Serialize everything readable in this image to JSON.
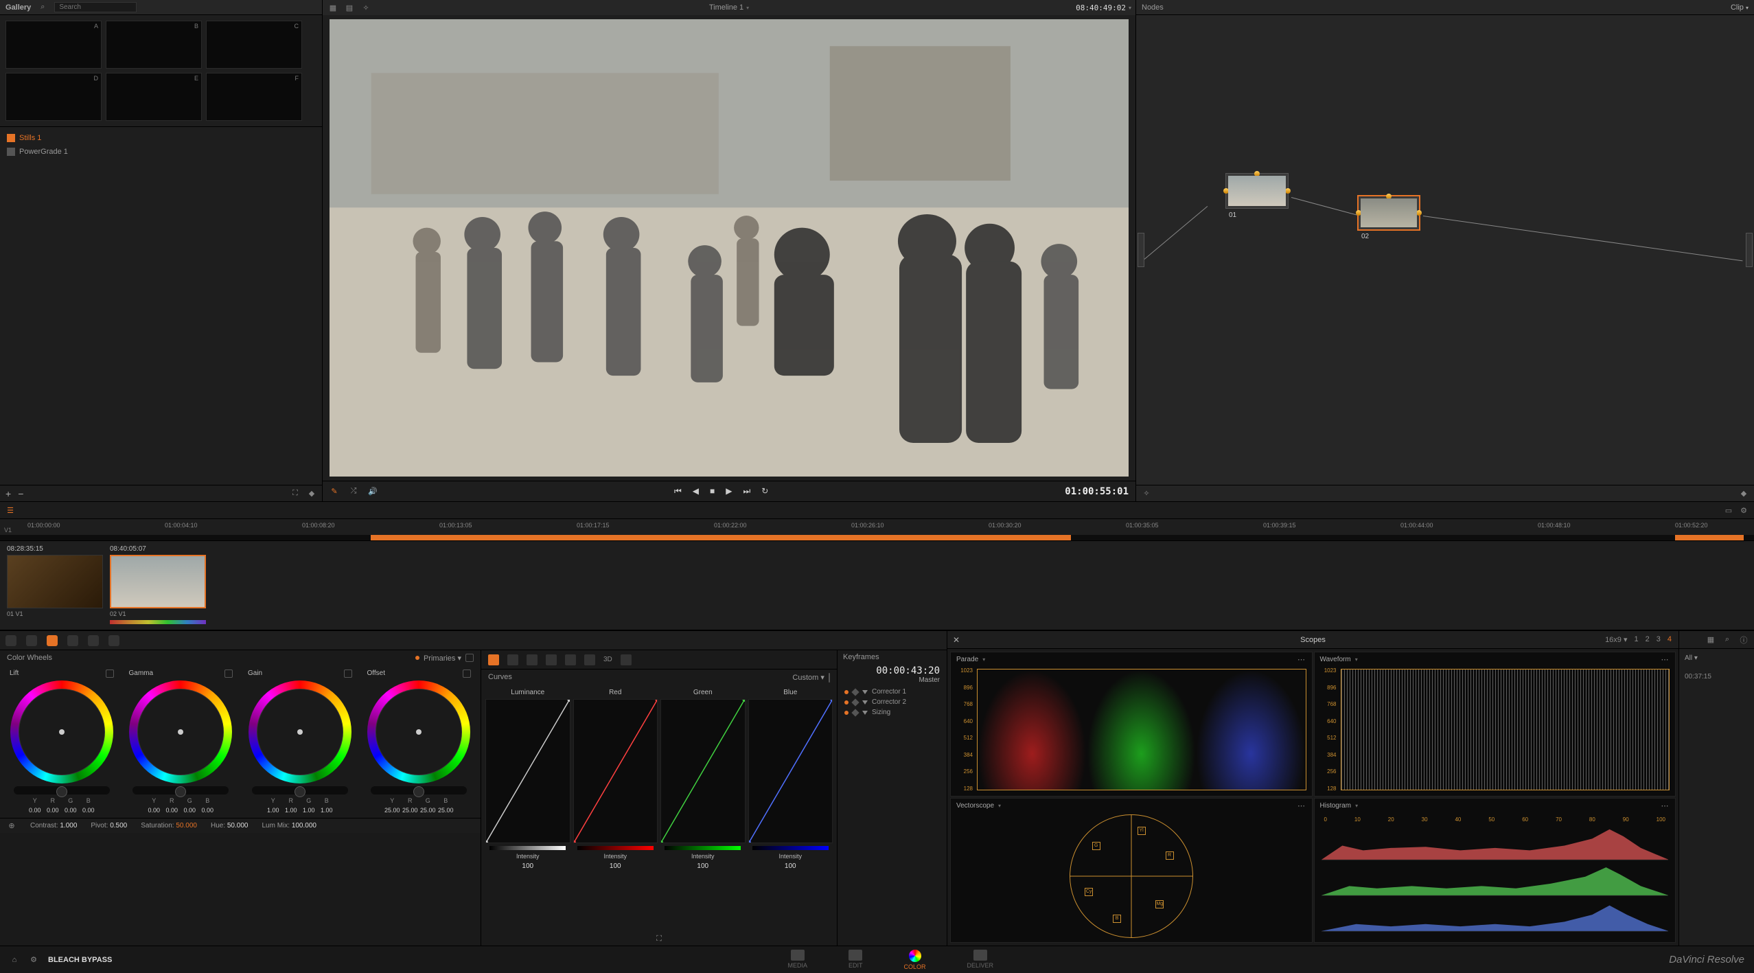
{
  "gallery": {
    "title": "Gallery",
    "search_placeholder": "Search",
    "thumbs": [
      {
        "label": "A",
        "num": ""
      },
      {
        "label": "B",
        "num": ""
      },
      {
        "label": "C",
        "num": ""
      },
      {
        "label": "D",
        "num": ""
      },
      {
        "label": "E",
        "num": ""
      },
      {
        "label": "F",
        "num": ""
      }
    ],
    "still_sub": "",
    "stills1": "Stills 1",
    "powergrade": "PowerGrade 1"
  },
  "viewer": {
    "title": "Timeline 1",
    "tc_header": "08:40:49:02",
    "tc_main": "01:00:55:01"
  },
  "nodes": {
    "title": "Nodes",
    "mode": "Clip",
    "node1": "01",
    "node2": "02"
  },
  "ruler": {
    "ticks": [
      "01:00:00:00",
      "01:00:04:10",
      "01:00:08:20",
      "01:00:13:05",
      "01:00:17:15",
      "01:00:22:00",
      "01:00:26:10",
      "01:00:30:20",
      "01:00:35:05",
      "01:00:39:15",
      "01:00:44:00",
      "01:00:48:10",
      "01:00:52:20"
    ],
    "track": "V1"
  },
  "clips": [
    {
      "tc": "08:28:35:15",
      "meta": "01    V1"
    },
    {
      "tc": "08:40:05:07",
      "meta": "02    V1"
    }
  ],
  "wheels": {
    "title": "Color Wheels",
    "mode": "Primaries",
    "cols": [
      {
        "name": "Lift",
        "vals": [
          "0.00",
          "0.00",
          "0.00",
          "0.00"
        ]
      },
      {
        "name": "Gamma",
        "vals": [
          "0.00",
          "0.00",
          "0.00",
          "0.00"
        ]
      },
      {
        "name": "Gain",
        "vals": [
          "1.00",
          "1.00",
          "1.00",
          "1.00"
        ]
      },
      {
        "name": "Offset",
        "vals": [
          "25.00",
          "25.00",
          "25.00",
          "25.00"
        ]
      }
    ],
    "yrgb": [
      "Y",
      "R",
      "G",
      "B"
    ],
    "footer": {
      "contrast_lbl": "Contrast:",
      "contrast": "1.000",
      "pivot_lbl": "Pivot:",
      "pivot": "0.500",
      "sat_lbl": "Saturation:",
      "sat": "50.000",
      "hue_lbl": "Hue:",
      "hue": "50.000",
      "lum_lbl": "Lum Mix:",
      "lum": "100.000"
    }
  },
  "curves": {
    "title": "Curves",
    "mode": "Custom",
    "cols": [
      {
        "name": "Luminance",
        "color": "white"
      },
      {
        "name": "Red",
        "color": "red"
      },
      {
        "name": "Green",
        "color": "green"
      },
      {
        "name": "Blue",
        "color": "blue"
      }
    ],
    "intensity_lbl": "Intensity",
    "intensity_val": "100"
  },
  "keyframes": {
    "title": "Keyframes",
    "tc": "00:00:43:20",
    "master": "Master",
    "rows": [
      "Corrector 1",
      "Corrector 2",
      "Sizing"
    ]
  },
  "scopes": {
    "title": "Scopes",
    "layout": "16x9",
    "opts": [
      "1",
      "2",
      "3",
      "4"
    ],
    "active": "4",
    "parade": {
      "title": "Parade",
      "ylabels": [
        "1023",
        "896",
        "768",
        "640",
        "512",
        "384",
        "256",
        "128"
      ]
    },
    "waveform": {
      "title": "Waveform",
      "ylabels": [
        "1023",
        "896",
        "768",
        "640",
        "512",
        "384",
        "256",
        "128"
      ]
    },
    "vector": {
      "title": "Vectorscope",
      "targets": [
        "R",
        "Mg",
        "B",
        "Cy",
        "G",
        "Yl"
      ]
    },
    "hist": {
      "title": "Histogram",
      "ruler": [
        "0",
        "10",
        "20",
        "30",
        "40",
        "50",
        "60",
        "70",
        "80",
        "90",
        "100"
      ]
    }
  },
  "sidetools": {
    "all": "All",
    "tc": "00:37:15"
  },
  "pages": {
    "project": "BLEACH BYPASS",
    "tabs": [
      "MEDIA",
      "EDIT",
      "COLOR",
      "DELIVER"
    ],
    "active": "COLOR",
    "brand": "DaVinci Resolve"
  }
}
